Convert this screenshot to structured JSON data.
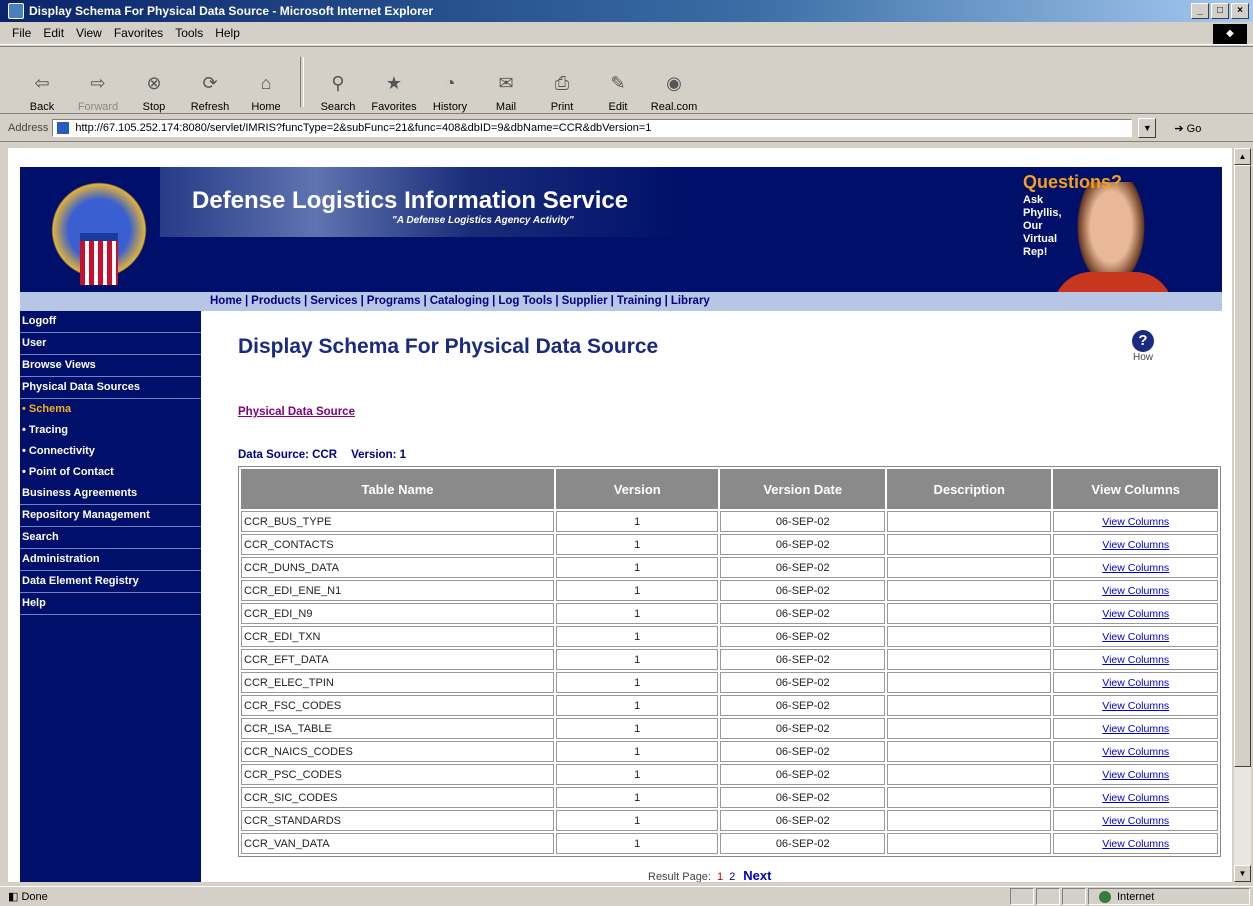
{
  "window": {
    "title": "Display Schema For Physical Data Source - Microsoft Internet Explorer",
    "buttons": [
      "_",
      "□",
      "×"
    ]
  },
  "menu": [
    "File",
    "Edit",
    "View",
    "Favorites",
    "Tools",
    "Help"
  ],
  "toolbar": [
    {
      "label": "Back",
      "icon": "back-arrow-icon",
      "enabled": true
    },
    {
      "label": "Forward",
      "icon": "forward-arrow-icon",
      "enabled": false
    },
    {
      "label": "Stop",
      "icon": "stop-icon",
      "enabled": true
    },
    {
      "label": "Refresh",
      "icon": "refresh-icon",
      "enabled": true
    },
    {
      "label": "Home",
      "icon": "home-icon",
      "enabled": true
    },
    {
      "label": "Search",
      "icon": "search-icon",
      "enabled": true
    },
    {
      "label": "Favorites",
      "icon": "favorites-icon",
      "enabled": true
    },
    {
      "label": "History",
      "icon": "history-icon",
      "enabled": true
    },
    {
      "label": "Mail",
      "icon": "mail-icon",
      "enabled": true
    },
    {
      "label": "Print",
      "icon": "print-icon",
      "enabled": true
    },
    {
      "label": "Edit",
      "icon": "edit-icon",
      "enabled": true
    },
    {
      "label": "Real.com",
      "icon": "real-icon",
      "enabled": true
    }
  ],
  "address": {
    "label": "Address",
    "url": "http://67.105.252.174:8080/servlet/IMRIS?funcType=2&subFunc=21&func=408&dbID=9&dbName=CCR&dbVersion=1",
    "go_label": "Go"
  },
  "banner": {
    "title": "Defense Logistics Information Service",
    "tagline": "\"A Defense Logistics Agency Activity\"",
    "questions_title": "Questions?",
    "questions_body": "Ask Phyllis, Our Virtual Rep!"
  },
  "nav_links": [
    "Home",
    "Products",
    "Services",
    "Programs",
    "Cataloging",
    "Log Tools",
    "Supplier",
    "Training",
    "Library"
  ],
  "sidebar": [
    {
      "label": "Logoff",
      "sub": false,
      "active": false
    },
    {
      "label": "User",
      "sub": false,
      "active": false
    },
    {
      "label": "Browse Views",
      "sub": false,
      "active": false
    },
    {
      "label": "Physical Data Sources",
      "sub": false,
      "active": false
    },
    {
      "label": "• Schema",
      "sub": true,
      "active": true
    },
    {
      "label": "• Tracing",
      "sub": true,
      "active": false
    },
    {
      "label": "• Connectivity",
      "sub": true,
      "active": false
    },
    {
      "label": "• Point of Contact",
      "sub": true,
      "active": false
    },
    {
      "label": "Business Agreements",
      "sub": false,
      "active": false
    },
    {
      "label": "Repository Management",
      "sub": false,
      "active": false
    },
    {
      "label": "Search",
      "sub": false,
      "active": false
    },
    {
      "label": "Administration",
      "sub": false,
      "active": false
    },
    {
      "label": "Data Element Registry",
      "sub": false,
      "active": false
    },
    {
      "label": "Help",
      "sub": false,
      "active": false
    }
  ],
  "main": {
    "title": "Display Schema For Physical Data Source",
    "help_label": "How",
    "breadcrumb": "Physical Data Source",
    "data_source_label": "Data Source: CCR",
    "version_label": "Version: 1"
  },
  "table": {
    "headers": [
      "Table Name",
      "Version",
      "Version Date",
      "Description",
      "View Columns"
    ],
    "rows": [
      [
        "CCR_BUS_TYPE",
        "1",
        "06-SEP-02",
        "",
        "View Columns"
      ],
      [
        "CCR_CONTACTS",
        "1",
        "06-SEP-02",
        "",
        "View Columns"
      ],
      [
        "CCR_DUNS_DATA",
        "1",
        "06-SEP-02",
        "",
        "View Columns"
      ],
      [
        "CCR_EDI_ENE_N1",
        "1",
        "06-SEP-02",
        "",
        "View Columns"
      ],
      [
        "CCR_EDI_N9",
        "1",
        "06-SEP-02",
        "",
        "View Columns"
      ],
      [
        "CCR_EDI_TXN",
        "1",
        "06-SEP-02",
        "",
        "View Columns"
      ],
      [
        "CCR_EFT_DATA",
        "1",
        "06-SEP-02",
        "",
        "View Columns"
      ],
      [
        "CCR_ELEC_TPIN",
        "1",
        "06-SEP-02",
        "",
        "View Columns"
      ],
      [
        "CCR_FSC_CODES",
        "1",
        "06-SEP-02",
        "",
        "View Columns"
      ],
      [
        "CCR_ISA_TABLE",
        "1",
        "06-SEP-02",
        "",
        "View Columns"
      ],
      [
        "CCR_NAICS_CODES",
        "1",
        "06-SEP-02",
        "",
        "View Columns"
      ],
      [
        "CCR_PSC_CODES",
        "1",
        "06-SEP-02",
        "",
        "View Columns"
      ],
      [
        "CCR_SIC_CODES",
        "1",
        "06-SEP-02",
        "",
        "View Columns"
      ],
      [
        "CCR_STANDARDS",
        "1",
        "06-SEP-02",
        "",
        "View Columns"
      ],
      [
        "CCR_VAN_DATA",
        "1",
        "06-SEP-02",
        "",
        "View Columns"
      ]
    ]
  },
  "pager": {
    "label": "Result Page:",
    "pages": [
      "1",
      "2"
    ],
    "next": "Next"
  },
  "status": {
    "text": "Done",
    "zone": "Internet"
  }
}
